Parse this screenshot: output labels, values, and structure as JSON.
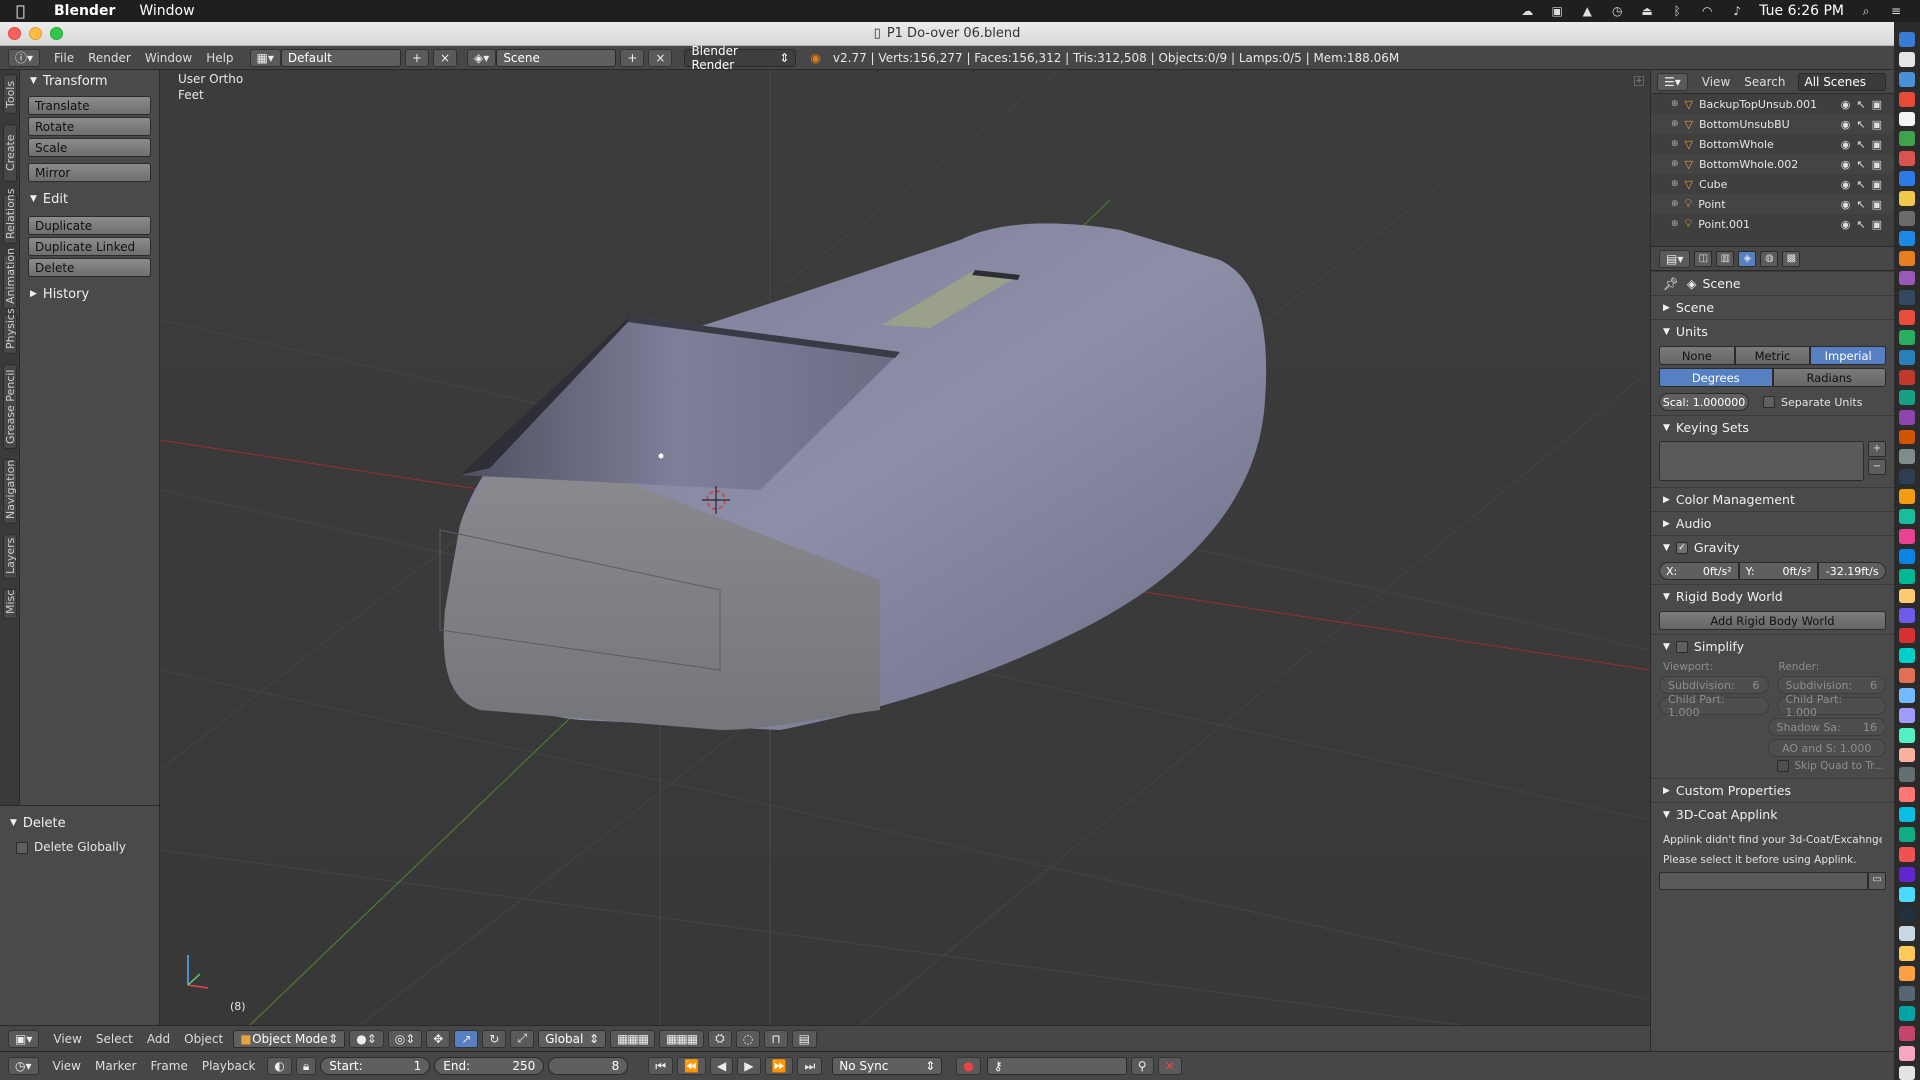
{
  "macbar": {
    "app": "Blender",
    "menu": [
      "Window"
    ],
    "clock": "Tue 6:26 PM"
  },
  "window": {
    "title": "P1 Do-over 06.blend"
  },
  "info_header": {
    "menus": [
      "File",
      "Render",
      "Window",
      "Help"
    ],
    "layout": "Default",
    "scene": "Scene",
    "engine": "Blender Render",
    "stats": "v2.77 | Verts:156,277 | Faces:156,312 | Tris:312,508 | Objects:0/9 | Lamps:0/5 | Mem:188.06M"
  },
  "tab_strip": [
    "Tools",
    "Create",
    "Relations",
    "Animation",
    "Physics",
    "Grease Pencil",
    "Navigation",
    "Layers",
    "Misc"
  ],
  "toolshelf": {
    "transform": {
      "title": "Transform",
      "buttons": [
        "Translate",
        "Rotate",
        "Scale",
        "Mirror"
      ]
    },
    "edit": {
      "title": "Edit",
      "buttons": [
        "Duplicate",
        "Duplicate Linked",
        "Delete"
      ]
    },
    "history": {
      "title": "History"
    }
  },
  "redo_panel": {
    "title": "Delete",
    "option": "Delete Globally"
  },
  "viewport": {
    "view_name": "User Ortho",
    "units": "Feet",
    "frame": "(8)"
  },
  "view3d_header": {
    "menus": [
      "View",
      "Select",
      "Add",
      "Object"
    ],
    "mode": "Object Mode",
    "orientation": "Global"
  },
  "timeline": {
    "menus": [
      "View",
      "Marker",
      "Frame",
      "Playback"
    ],
    "start_label": "Start:",
    "start": "1",
    "end_label": "End:",
    "end": "250",
    "current": "8",
    "sync": "No Sync"
  },
  "outliner": {
    "menus": [
      "View",
      "Search"
    ],
    "filter": "All Scenes",
    "items": [
      "BackupTopUnsub.001",
      "BottomUnsubBU",
      "BottomWhole",
      "BottomWhole.002",
      "Cube",
      "Point",
      "Point.001"
    ]
  },
  "properties": {
    "breadcrumb": "Scene",
    "sections": {
      "scene": "Scene",
      "units": "Units",
      "unit_systems": [
        "None",
        "Metric",
        "Imperial"
      ],
      "rotation": [
        "Degrees",
        "Radians"
      ],
      "scale": "Scal: 1.000000",
      "separate_units": "Separate Units",
      "keying_sets": "Keying Sets",
      "color_management": "Color Management",
      "audio": "Audio",
      "gravity": "Gravity",
      "gravity_x": "X:",
      "gravity_x_val": "0ft/s²",
      "gravity_y": "Y:",
      "gravity_y_val": "0ft/s²",
      "gravity_z": "-32.19ft/s",
      "rigid_body_world": "Rigid Body World",
      "add_rigid_body_world": "Add Rigid Body World",
      "simplify": "Simplify",
      "viewport": "Viewport:",
      "render": "Render:",
      "subdivision": "Subdivision:",
      "subdivision_val": "6",
      "child_part": "Child Part: 1.000",
      "shadow": "Shadow Sa:",
      "shadow_val": "16",
      "ao": "AO and S: 1.000",
      "skip_quad": "Skip Quad to Tr...",
      "custom_properties": "Custom Properties",
      "coat": "3D-Coat Applink",
      "coat_msg1": "Applink didn't find your 3d-Coat/Excahnge fo",
      "coat_msg2": "Please select it before using Applink."
    }
  },
  "colors": {
    "accent": "#5680c2",
    "x_axis": "#c8383a",
    "y_axis": "#6ab437",
    "mesh": "#8d8ea8"
  }
}
